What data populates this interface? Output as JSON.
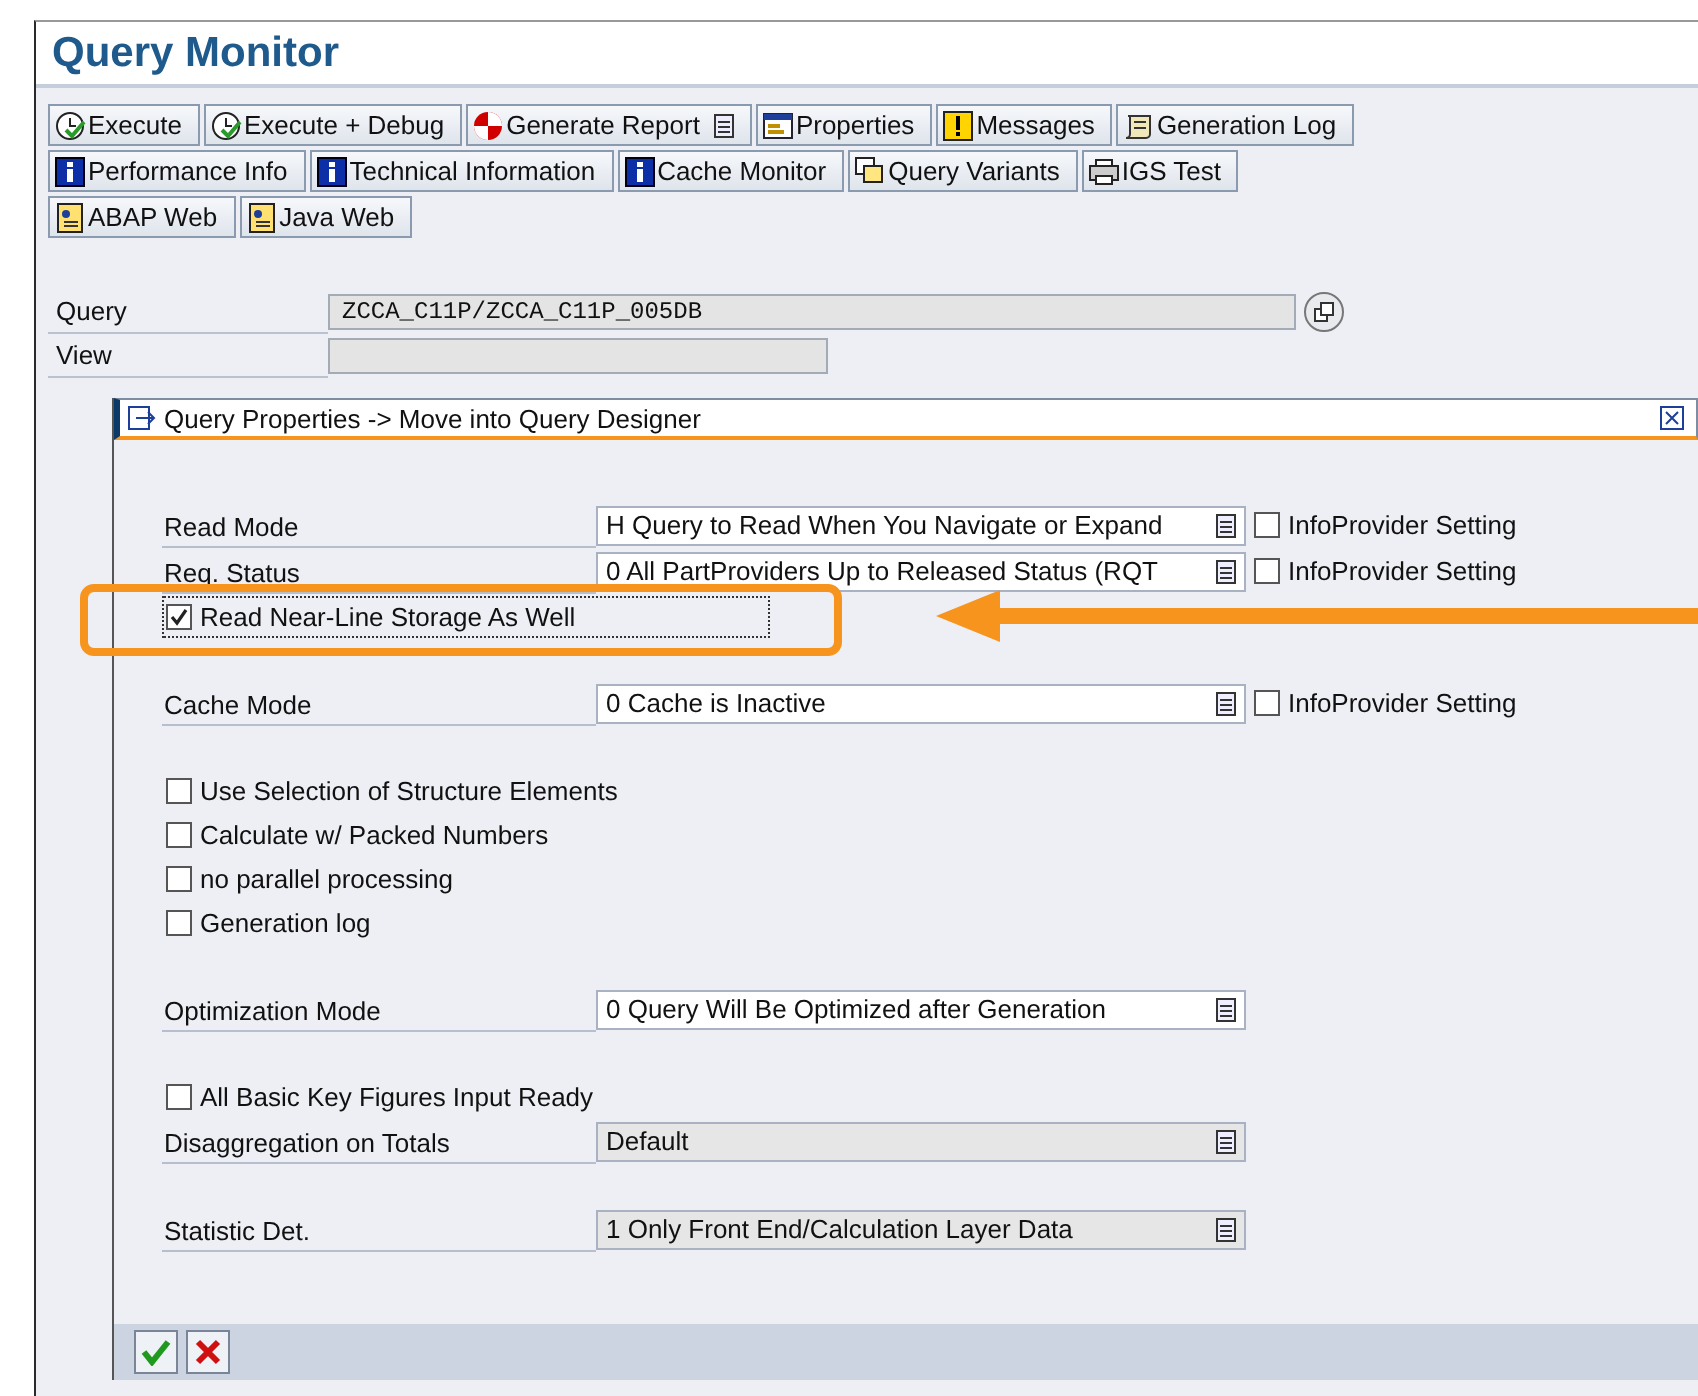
{
  "title": "Query Monitor",
  "toolbar_rows": [
    {
      "buttons": [
        {
          "label": "Execute",
          "kind": "execute",
          "menu": false
        },
        {
          "label": "Execute + Debug",
          "kind": "execute",
          "menu": false
        },
        {
          "label": "Generate Report",
          "kind": "report",
          "menu": true
        },
        {
          "label": "Properties",
          "kind": "properties",
          "menu": false
        },
        {
          "label": "Messages",
          "kind": "messages",
          "menu": false
        },
        {
          "label": "Generation Log",
          "kind": "log",
          "menu": false
        }
      ]
    },
    {
      "buttons": [
        {
          "label": "Performance Info",
          "kind": "info",
          "menu": false
        },
        {
          "label": "Technical Information",
          "kind": "info",
          "menu": false
        },
        {
          "label": "Cache Monitor",
          "kind": "info",
          "menu": false
        },
        {
          "label": "Query Variants",
          "kind": "variants",
          "menu": false
        },
        {
          "label": "IGS Test",
          "kind": "igs",
          "menu": false
        }
      ]
    },
    {
      "buttons": [
        {
          "label": "ABAP Web",
          "kind": "web",
          "menu": false
        },
        {
          "label": "Java Web",
          "kind": "web",
          "menu": false
        }
      ]
    }
  ],
  "query_fields": [
    {
      "label": "Query",
      "value": "ZCCA_C11P/ZCCA_C11P_005DB",
      "value_help": true
    },
    {
      "label": "View",
      "value_help": false
    }
  ],
  "dialog": {
    "title": "Query Properties -> Move into Query Designer",
    "groups": [
      {
        "rows": [
          {
            "kind": "select",
            "label": "Read Mode",
            "value": "H Query to Read When You Navigate or Expand",
            "disabled": false,
            "setting": {
              "label": "InfoProvider Setting",
              "checked": false
            }
          },
          {
            "kind": "select",
            "label": "Req. Status",
            "value": "0 All PartProviders Up to Released Status (RQT",
            "disabled": false,
            "setting": {
              "label": "InfoProvider Setting",
              "checked": false
            }
          },
          {
            "kind": "check",
            "label": "Read Near-Line Storage As Well",
            "checked": true,
            "focused": true
          }
        ]
      },
      {
        "rows": [
          {
            "kind": "select",
            "label": "Cache Mode",
            "value": "0 Cache is Inactive",
            "disabled": false,
            "setting": {
              "label": "InfoProvider Setting",
              "checked": false
            }
          }
        ]
      },
      {
        "rows": [
          {
            "kind": "check",
            "label": "Use Selection of Structure Elements",
            "checked": false,
            "focused": false
          },
          {
            "kind": "check",
            "label": "Calculate w/ Packed Numbers",
            "checked": false,
            "focused": false
          },
          {
            "kind": "check",
            "label": "no parallel processing",
            "checked": false,
            "focused": false
          },
          {
            "kind": "check",
            "label": "Generation log",
            "checked": false,
            "focused": false
          }
        ]
      },
      {
        "rows": [
          {
            "kind": "select",
            "label": "Optimization Mode",
            "value": "0 Query Will Be Optimized after Generation",
            "disabled": false
          }
        ]
      },
      {
        "rows": [
          {
            "kind": "check",
            "label": "All Basic Key Figures Input Ready",
            "checked": false,
            "focused": false
          },
          {
            "kind": "select",
            "label": "Disaggregation on Totals",
            "value": "Default",
            "disabled": true
          }
        ]
      },
      {
        "rows": [
          {
            "kind": "select",
            "label": "Statistic Det.",
            "value": "1 Only Front End/Calculation Layer Data",
            "disabled": true
          }
        ]
      }
    ],
    "buttons": [
      {
        "kind": "confirm"
      },
      {
        "kind": "cancel"
      }
    ]
  }
}
